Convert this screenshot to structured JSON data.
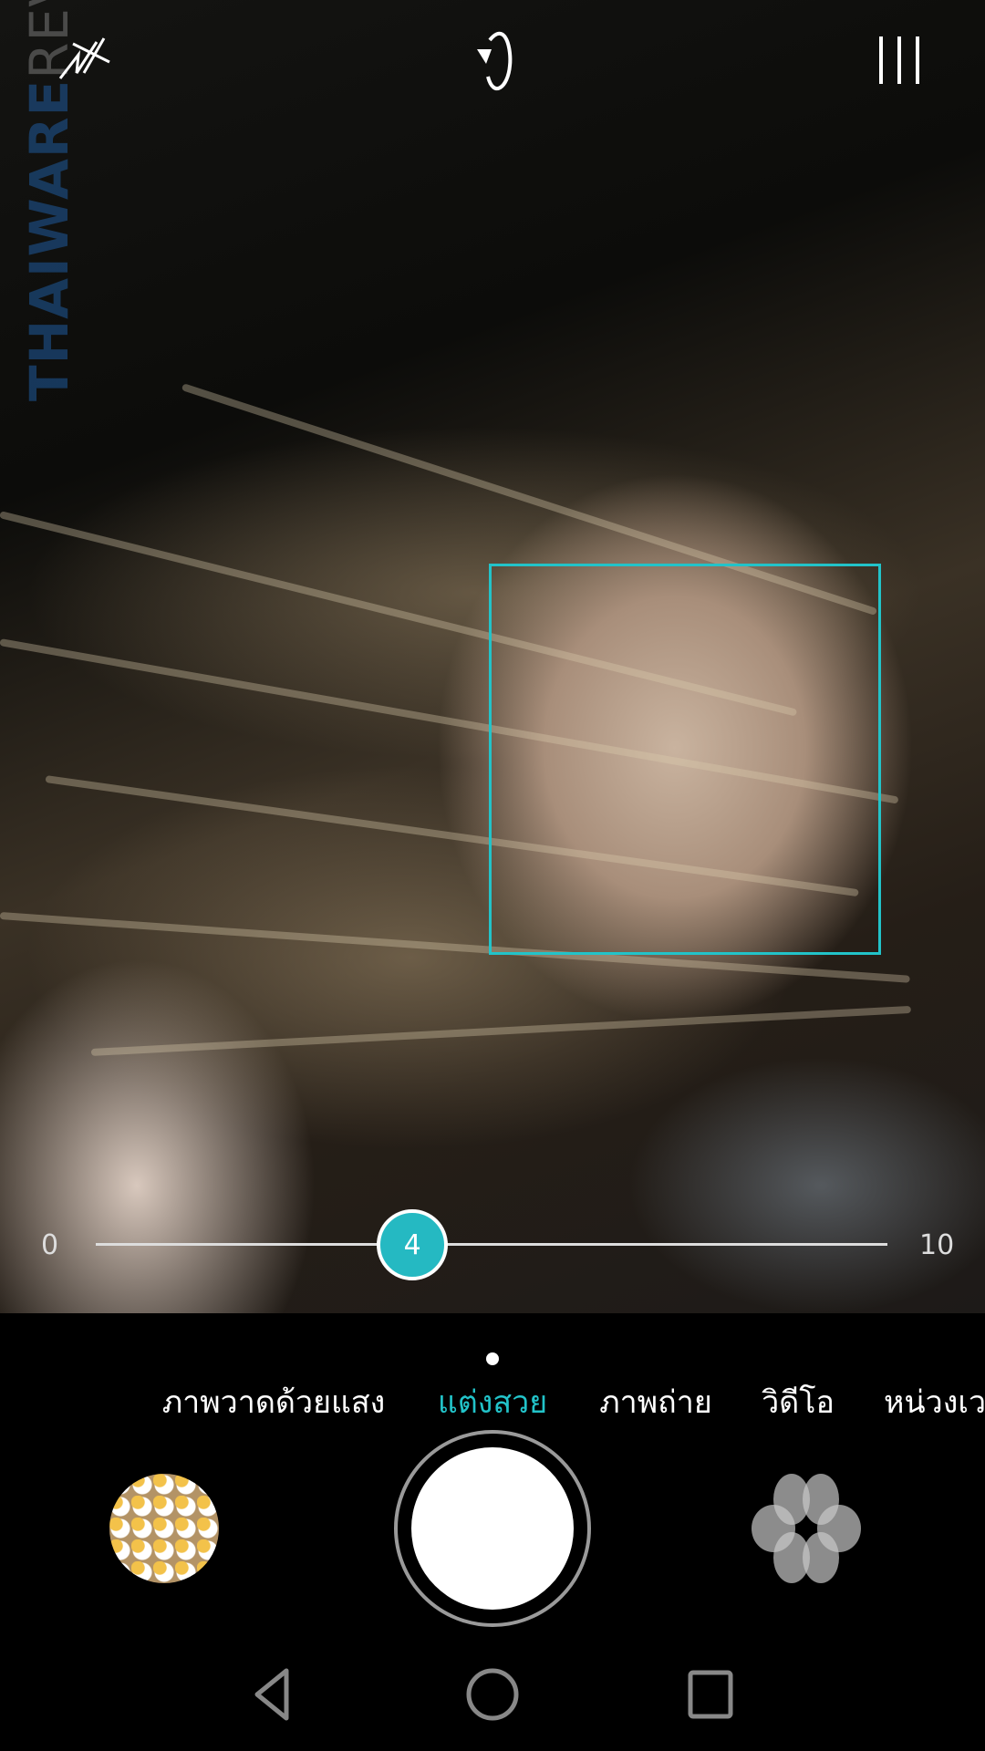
{
  "watermark": {
    "text1": "THAIWARE",
    "text2": "REVIEWS"
  },
  "top_bar": {
    "icons": [
      "flash-off-icon",
      "switch-camera-icon",
      "menu-icon"
    ]
  },
  "beauty_slider": {
    "min_label": "0",
    "max_label": "10",
    "value": 4,
    "value_label": "4",
    "accent": "#25b9c2"
  },
  "face_detect": {
    "color": "#22c3c9"
  },
  "modes": [
    {
      "label": "ภาพวาดด้วยแสง",
      "active": false
    },
    {
      "label": "แต่งสวย",
      "active": true
    },
    {
      "label": "ภาพถ่าย",
      "active": false
    },
    {
      "label": "วิดีโอ",
      "active": false
    },
    {
      "label": "หน่วงเวลา",
      "active": false
    }
  ],
  "bottom_bar": {
    "icons": [
      "gallery-thumbnail",
      "shutter-button",
      "beauty-filter-icon"
    ]
  },
  "nav_bar": {
    "icons": [
      "back-icon",
      "home-icon",
      "recents-icon"
    ]
  }
}
